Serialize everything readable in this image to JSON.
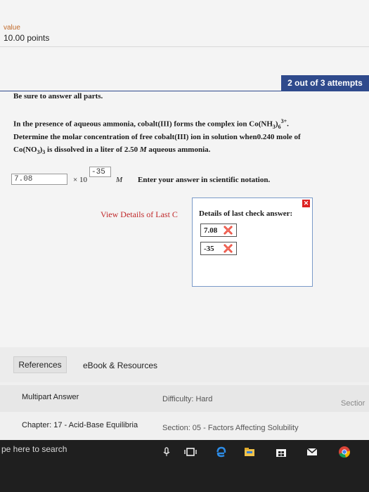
{
  "header": {
    "value_label": "value",
    "points": "10.00 points"
  },
  "attempts_badge": "2 out of 3 attempts",
  "instructions": "Be sure to answer all parts.",
  "question": {
    "line1_text": "In the presence of aqueous ammonia, cobalt(III) forms the complex ion Co(NH",
    "line1_sub3": "3",
    "line1_sub6": "6",
    "line1_sup": "3+",
    "line1_end": ".",
    "line2_text": "Determine the molar concentration of free cobalt(III) ion in solution when",
    "line2_value": "0.240 mole of",
    "line3_co": "Co(NO",
    "line3_sub3a": "3",
    "line3_sub3b": "3",
    "line3_rest": " is dissolved in a liter of 2.50 ",
    "line3_M": "M",
    "line3_end": " aqueous ammonia."
  },
  "answer": {
    "mantissa_value": "7.08",
    "times_label": "× 10",
    "exponent_value": "-35",
    "unit": "M",
    "hint": "Enter your answer in scientific notation."
  },
  "view_details_link": "View Details of Last C",
  "details_popup": {
    "close_glyph": "✕",
    "title": "Details of last check answer:",
    "checks": [
      {
        "value": "7.08",
        "status": "incorrect"
      },
      {
        "value": "-35",
        "status": "incorrect"
      }
    ]
  },
  "tabs": {
    "references": "References",
    "ebook": "eBook & Resources"
  },
  "info": {
    "multipart": "Multipart Answer",
    "difficulty": "Difficulty: Hard",
    "section_cut": "Sectior",
    "chapter": "Chapter: 17 - Acid-Base Equilibria",
    "section": "Section: 05 - Factors Affecting Solubility"
  },
  "taskbar": {
    "search_placeholder": "pe here to search",
    "icons": [
      "mic-icon",
      "task-view-icon",
      "edge-icon",
      "file-explorer-icon",
      "store-icon",
      "mail-icon",
      "chrome-icon"
    ]
  },
  "colors": {
    "attempts_bg": "#2f4a8c",
    "error_red": "#c0282a",
    "popup_border": "#7a9ac8"
  }
}
